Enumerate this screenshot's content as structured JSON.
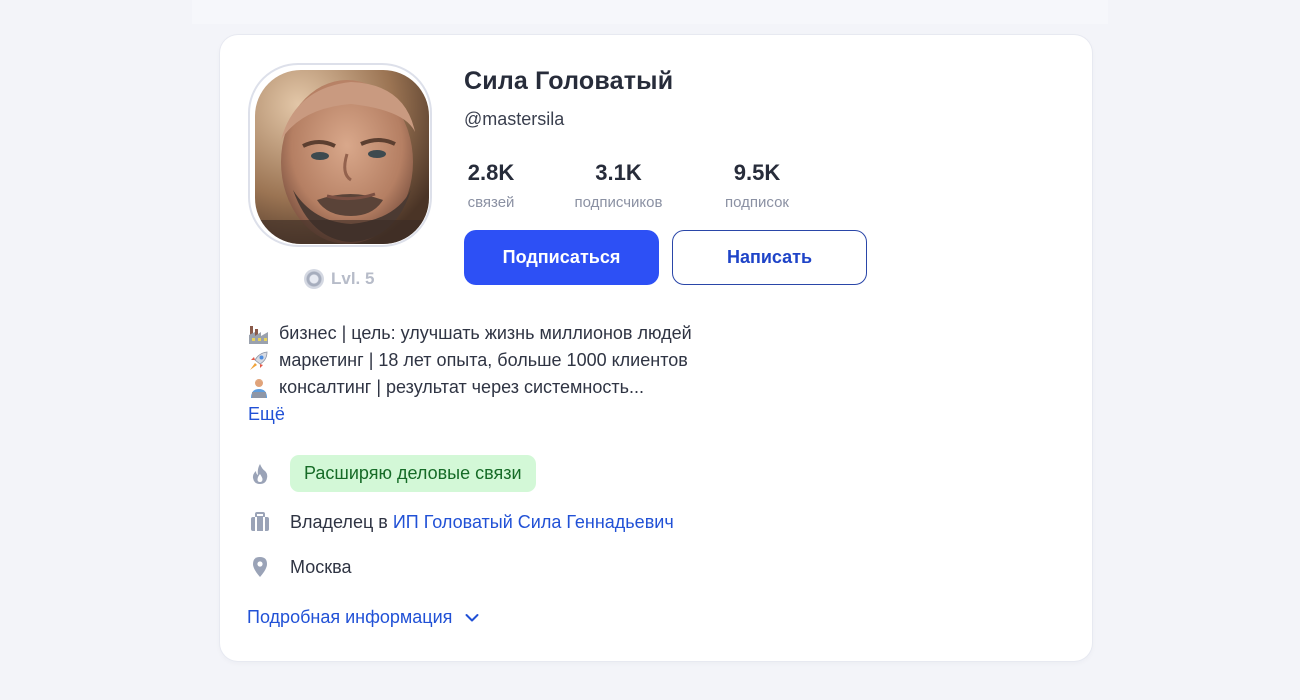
{
  "profile": {
    "name": "Сила Головатый",
    "handle": "@mastersila",
    "level": "Lvl. 5"
  },
  "stats": [
    {
      "value": "2.8K",
      "label": "связей"
    },
    {
      "value": "3.1K",
      "label": "подписчиков"
    },
    {
      "value": "9.5K",
      "label": "подписок"
    }
  ],
  "actions": {
    "subscribe_label": "Подписаться",
    "message_label": "Написать"
  },
  "bio": {
    "lines": [
      {
        "icon": "factory-emoji",
        "text": "бизнес | цель: улучшать жизнь миллионов людей"
      },
      {
        "icon": "rocket-emoji",
        "text": "маркетинг | 18 лет опыта, больше 1000 клиентов"
      },
      {
        "icon": "person-at-computer-emoji",
        "text": "консалтинг | результат через системность..."
      }
    ],
    "more_label": "Ещё"
  },
  "info": {
    "goal_tag": "Расширяю деловые связи",
    "job_prefix": "Владелец в ",
    "company": "ИП Головатый Сила Геннадьевич",
    "city": "Москва",
    "details_label": "Подробная информация"
  },
  "icons": {
    "goal": "flame-icon",
    "job": "briefcase-icon",
    "city": "location-pin-icon",
    "details": "chevron-down-icon"
  },
  "colors": {
    "primary": "#2d50f5",
    "link": "#2151d6",
    "tag_bg": "#d3f8d7",
    "tag_text": "#166b27",
    "muted_icon": "#9aa3b7"
  }
}
